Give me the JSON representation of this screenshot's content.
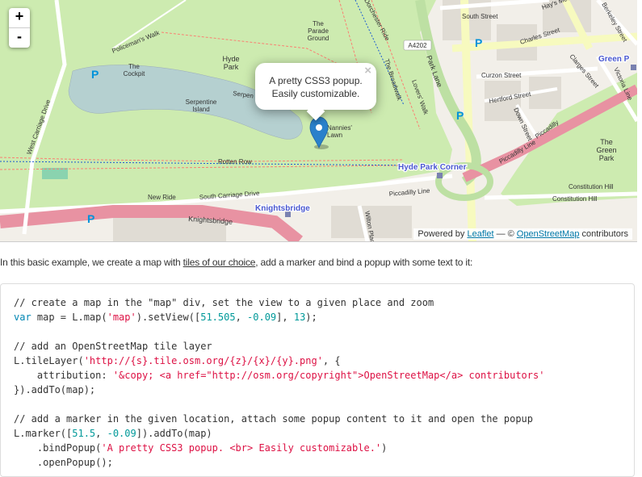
{
  "map": {
    "zoom_in": "+",
    "zoom_out": "-",
    "popup": {
      "line1": "A pretty CSS3 popup.",
      "line2": "Easily customizable.",
      "close": "×"
    },
    "labels": {
      "the_parade_ground": [
        "The",
        "Parade",
        "Ground"
      ],
      "hyde_park": [
        "Hyde",
        "Park"
      ],
      "policemans_walk": "Policeman's Walk",
      "the_cockpit": [
        "The",
        "Cockpit"
      ],
      "serpentine_island": [
        "Serpentine",
        "Island"
      ],
      "serpentine": "Serpen",
      "nannies_lawn": [
        "Nannies'",
        "Lawn"
      ],
      "rotten_row": "Rotten Row",
      "new_ride": "New Ride",
      "south_carriage_drive": "South Carriage Drive",
      "knightsbridge_road": "Knightsbridge",
      "knightsbridge_station": "Knightsbridge",
      "west_carriage_drive": "West Carriage Drive",
      "the_broadwalk": "The Broadwalk",
      "park_lane": "Park Lane",
      "lovers_walk": "Lovers' Walk",
      "a4202": "A4202",
      "curzon_street": "Curzon Street",
      "hertford_street": "Hertford Street",
      "down_street": "Down Street",
      "piccadilly": "Piccadilly",
      "piccadilly_line": "Piccadilly Line",
      "hyde_park_corner": "Hyde Park Corner",
      "constitution_hill": "Constitution Hill",
      "green_park_station": "Green P",
      "green_park": [
        "The",
        "Green",
        "Park"
      ],
      "south_street": "South Street",
      "hays_mews": "Hay's Mews",
      "charles_street": "Charles Street",
      "clarges_street": "Clarges Street",
      "berkeley_street": "Berkeley Street",
      "victoria_line": "Victoria Line",
      "dorchester_ride": "Dorchester Ride",
      "wilton_place": "Wilton Place",
      "parking": "P"
    },
    "attribution": {
      "prefix": "Powered by",
      "leaflet": "Leaflet",
      "sep": "— ©",
      "osm": "OpenStreetMap",
      "suffix": "contributors"
    },
    "colors": {
      "park": "#cdebb0",
      "water": "#b5d0d0",
      "land": "#f2efe9",
      "major_road": "#e892a2",
      "yellow_road": "#f7fabf",
      "marker": "#2a81cb",
      "station": "#7981b0"
    }
  },
  "intro": {
    "before": "In this basic example, we create a map with",
    "link1": "tiles of our choice",
    "middle": ", add a marker and bind a popup with some text to it:"
  },
  "code": {
    "l1": "// create a map in the \"map\" div, set the view to a given place and zoom",
    "l2_kw": "var",
    "l2_a": " map = L.map(",
    "l2_s": "'map'",
    "l2_b": ").setView([",
    "l2_n1": "51.505",
    "l2_c": ", ",
    "l2_n2": "-0.09",
    "l2_d": "], ",
    "l2_n3": "13",
    "l2_e": ");",
    "l4": "// add an OpenStreetMap tile layer",
    "l5_a": "L.tileLayer(",
    "l5_s": "'http://{s}.tile.osm.org/{z}/{x}/{y}.png'",
    "l5_b": ", {",
    "l6_a": "    attribution: ",
    "l6_s": "'&copy; <a href=\"http://osm.org/copyright\">OpenStreetMap</a> contributors'",
    "l7": "}).addTo(map);",
    "l9": "// add a marker in the given location, attach some popup content to it and open the popup",
    "l10_a": "L.marker([",
    "l10_n1": "51.5",
    "l10_b": ", ",
    "l10_n2": "-0.09",
    "l10_c": "]).addTo(map)",
    "l11_a": "    .bindPopup(",
    "l11_s": "'A pretty CSS3 popup. <br> Easily customizable.'",
    "l11_b": ")",
    "l12": "    .openPopup();"
  }
}
